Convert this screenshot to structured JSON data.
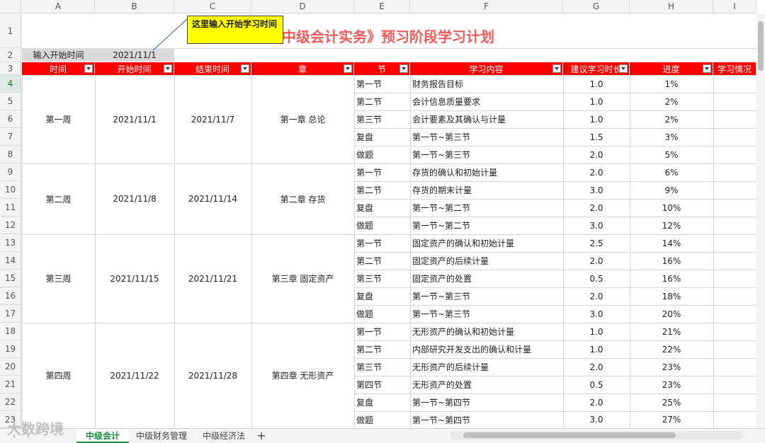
{
  "columns": [
    "A",
    "B",
    "C",
    "D",
    "E",
    "F",
    "G",
    "H",
    "I"
  ],
  "rows": [
    "1",
    "2",
    "3",
    "4",
    "5",
    "6",
    "7",
    "8",
    "9",
    "10",
    "11",
    "12",
    "13",
    "14",
    "15",
    "16",
    "17",
    "18",
    "19",
    "20",
    "21",
    "22",
    "23"
  ],
  "title": "中级会计实务》预习阶段学习计划",
  "note": "这里输入开始学习时间",
  "start_label": "输入开始时间",
  "start_value": "2021/11/1",
  "headers": [
    "时间",
    "开始时间",
    "结束时间",
    "章",
    "节",
    "学习内容",
    "建议学习时长",
    "进度",
    "学习情况"
  ],
  "weeks": [
    {
      "week": "第一周",
      "start": "2021/11/1",
      "end": "2021/11/7",
      "chapter": "第一章 总论"
    },
    {
      "week": "第二周",
      "start": "2021/11/8",
      "end": "2021/11/14",
      "chapter": "第二章 存货"
    },
    {
      "week": "第三周",
      "start": "2021/11/15",
      "end": "2021/11/21",
      "chapter": "第三章 固定资产"
    },
    {
      "week": "第四周",
      "start": "2021/11/22",
      "end": "2021/11/28",
      "chapter": "第四章 无形资产"
    }
  ],
  "rows_data": [
    {
      "section": "第一节",
      "content": "财务报告目标",
      "hours": "1.0",
      "progress": "1%"
    },
    {
      "section": "第二节",
      "content": "会计信息质量要求",
      "hours": "1.0",
      "progress": "2%"
    },
    {
      "section": "第三节",
      "content": "会计要素及其确认与计量",
      "hours": "1.0",
      "progress": "2%"
    },
    {
      "section": "复盘",
      "content": "第一节~第三节",
      "hours": "1.5",
      "progress": "3%"
    },
    {
      "section": "做题",
      "content": "第一节~第三节",
      "hours": "2.0",
      "progress": "5%"
    },
    {
      "section": "第一节",
      "content": "存货的确认和初始计量",
      "hours": "2.0",
      "progress": "6%"
    },
    {
      "section": "第二节",
      "content": "存货的期末计量",
      "hours": "3.0",
      "progress": "9%"
    },
    {
      "section": "复盘",
      "content": "第一节~第二节",
      "hours": "2.0",
      "progress": "10%"
    },
    {
      "section": "做题",
      "content": "第一节~第二节",
      "hours": "3.0",
      "progress": "12%"
    },
    {
      "section": "第一节",
      "content": "固定资产的确认和初始计量",
      "hours": "2.5",
      "progress": "14%"
    },
    {
      "section": "第二节",
      "content": "固定资产的后续计量",
      "hours": "2.0",
      "progress": "16%"
    },
    {
      "section": "第三节",
      "content": "固定资产的处置",
      "hours": "0.5",
      "progress": "16%"
    },
    {
      "section": "复盘",
      "content": "第一节~第三节",
      "hours": "2.0",
      "progress": "18%"
    },
    {
      "section": "做题",
      "content": "第一节~第三节",
      "hours": "3.0",
      "progress": "20%"
    },
    {
      "section": "第一节",
      "content": "无形资产的确认和初始计量",
      "hours": "1.0",
      "progress": "21%"
    },
    {
      "section": "第二节",
      "content": "内部研究开发支出的确认和计量",
      "hours": "1.0",
      "progress": "22%"
    },
    {
      "section": "第三节",
      "content": "无形资产的后续计量",
      "hours": "2.0",
      "progress": "23%"
    },
    {
      "section": "第四节",
      "content": "无形资产的处置",
      "hours": "0.5",
      "progress": "23%"
    },
    {
      "section": "复盘",
      "content": "第一节~第四节",
      "hours": "2.0",
      "progress": "25%"
    },
    {
      "section": "做题",
      "content": "第一节~第四节",
      "hours": "3.0",
      "progress": "27%"
    }
  ],
  "tabs": [
    "中级会计",
    "中级财务管理",
    "中级经济法"
  ],
  "add_tab": "+",
  "watermark": "大数跨境",
  "colors": {
    "header_red": "#ff0000",
    "title": "#f05a5a",
    "note_yellow": "#ffff00",
    "tab_green": "#1a8a45"
  }
}
